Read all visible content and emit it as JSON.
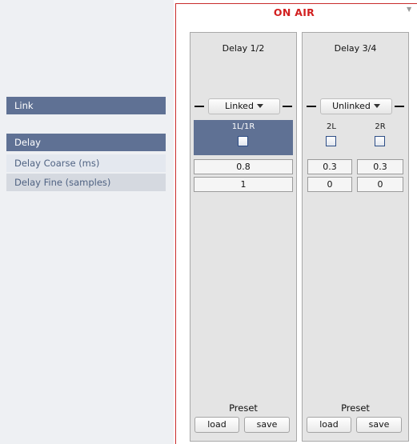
{
  "sidebar": {
    "link_header": "Link",
    "delay_header": "Delay",
    "delay_coarse_label": "Delay Coarse (ms)",
    "delay_fine_label": "Delay Fine (samples)"
  },
  "header": {
    "status": "ON AIR"
  },
  "channels": [
    {
      "title": "Delay 1/2",
      "link_state": "Linked",
      "labels": [
        "1L/1R"
      ],
      "checkbox_states": [
        false
      ],
      "delay_coarse": [
        "0.8"
      ],
      "delay_fine": [
        "1"
      ],
      "preset_label": "Preset",
      "load_label": "load",
      "save_label": "save"
    },
    {
      "title": "Delay 3/4",
      "link_state": "Unlinked",
      "labels": [
        "2L",
        "2R"
      ],
      "checkbox_states": [
        false,
        false
      ],
      "delay_coarse": [
        "0.3",
        "0.3"
      ],
      "delay_fine": [
        "0",
        "0"
      ],
      "preset_label": "Preset",
      "load_label": "load",
      "save_label": "save"
    }
  ],
  "colors": {
    "header_band": "#5f7194",
    "on_air": "#d21f1f",
    "channel_bg": "#e4e4e4",
    "sidebar_bg": "#eef0f3"
  },
  "icons": {
    "dropdown": "chevron-down-icon",
    "corner": "small-triangle-down-icon"
  }
}
